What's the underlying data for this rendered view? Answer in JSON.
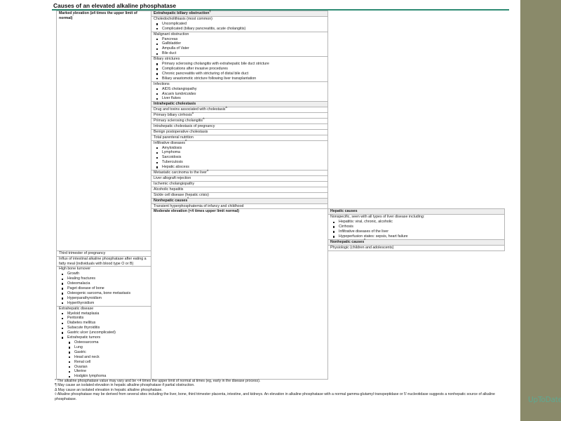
{
  "title": "Causes of an elevated alkaline phosphatase",
  "marked_label": "Marked elevation (≥4 times the upper limit of normal)",
  "moderate_label": "Moderate elevation (<4 times upper limit normal)",
  "sections": {
    "extrahepatic": {
      "heading": "Extrahepatic biliary obstruction",
      "heading_mark": "¶",
      "choledo": {
        "title": "Choledocholithiasis (most common)",
        "items": [
          "Uncomplicated",
          "Complicated (biliary pancreatitis, acute cholangitis)"
        ]
      },
      "malignant": {
        "title": "Malignant obstruction",
        "items": [
          "Pancreas",
          "Gallbladder",
          "Ampulla of Vater",
          "Bile duct"
        ]
      },
      "strictures": {
        "title": "Biliary strictures",
        "items": [
          "Primary sclerosing cholangitis with extrahepatic bile duct stricture",
          "Complications after invasive procedures",
          "Chronic pancreatitis with stricturing of distal bile duct",
          "Biliary anastomotic stricture following liver transplantation"
        ]
      },
      "infections": {
        "title": "Infections",
        "items": [
          "AIDS cholangiopathy",
          "Ascaris lumbricoides",
          "Liver flukes"
        ]
      }
    },
    "intrahepatic": {
      "heading": "Intrahepatic cholestasis",
      "drug": "Drug and toxins associated with cholestasis",
      "drug_mark": "Δ",
      "pbc": "Primary biliary cirrhosis",
      "pbc_mark": "Δ",
      "psc": "Primary sclerosing cholangitis",
      "psc_mark": "Δ",
      "pregnancy": "Intrahepatic cholestasis of pregnancy",
      "benign_postop": "Benign postoperative cholestasis",
      "tpn": "Total parenteral nutrition",
      "infiltrative": {
        "title": "Infiltrative diseases",
        "mark": "Δ",
        "items": [
          "Amyloidosis",
          "Lymphoma",
          "Sarcoidosis",
          "Tuberculosis",
          "Hepatic abscess"
        ]
      },
      "metastatic": "Metastatic carcinoma to the liver",
      "metastatic_mark": "Δ",
      "allograft": "Liver allograft rejection",
      "ischemic": "Ischemic cholangiopathy",
      "alcoholic": "Alcoholic hepatitis",
      "sickle": "Sickle cell disease (hepatic crisis)"
    },
    "nonhepatic_marked": {
      "heading": "Nonhepatic causes",
      "mark": "◊",
      "item": "Transient hyperphosphatemia of infancy and childhood"
    },
    "hepatic_moderate": {
      "heading": "Hepatic causes",
      "title": "Nonspecific, seen with all types of liver disease including:",
      "items": [
        "Hepatitis: viral, chronic, alcoholic",
        "Cirrhosis",
        "Infiltrative diseases of the liver",
        "Hypoperfusion states: sepsis, heart failure"
      ]
    },
    "nonhepatic_moderate": {
      "heading": "Nonhepatic causes",
      "mark": "◊",
      "physiologic": "Physiologic (children and adolescents)",
      "third_trimester": "Third trimester of pregnancy",
      "influx": "Influx of intestinal alkaline phosphatase after eating a fatty meal (individuals with blood type O or B)",
      "bone": {
        "title": "High bone turnover",
        "items": [
          "Growth",
          "Healing fractures",
          "Osteomalacia",
          "Paget disease of bone",
          "Osteogenic sarcoma, bone metastasis",
          "Hyperparathyroidism",
          "Hyperthyroidism"
        ]
      },
      "extrahepatic_disease": {
        "title": "Extrahepatic disease",
        "items": [
          "Myeloid metaplasia",
          "Peritonitis",
          "Diabetes mellitus",
          "Subacute thyroiditis",
          "Gastric ulcer (uncomplicated)",
          "Extrahepatic tumors"
        ],
        "tumors": [
          "Osteosarcoma",
          "Lung",
          "Gastric",
          "Head and neck",
          "Renal cell",
          "Ovarian",
          "Uterine",
          "Hodgkin lymphoma"
        ]
      }
    }
  },
  "footnotes": [
    "* The alkaline phosphatase value may vary and be <4 times the upper limit of normal at times (eg, early in the disease process).",
    "¶ May cause an isolated elevation in hepatic alkaline phosphatase if partial obstruction.",
    "Δ May cause an isolated elevation in hepatic alkaline phosphatase.",
    "◊ Alkaline phosphatase may be derived from several sites including the liver, bone, third trimester placenta, intestine, and kidneys. An elevation in alkaline phosphatase with a normal gamma-glutamyl transpeptidase or 5'-nucleotidase suggests a nonhepatic source of alkaline phosphatase."
  ],
  "brand": "UpToDate",
  "brand_mark": "®"
}
